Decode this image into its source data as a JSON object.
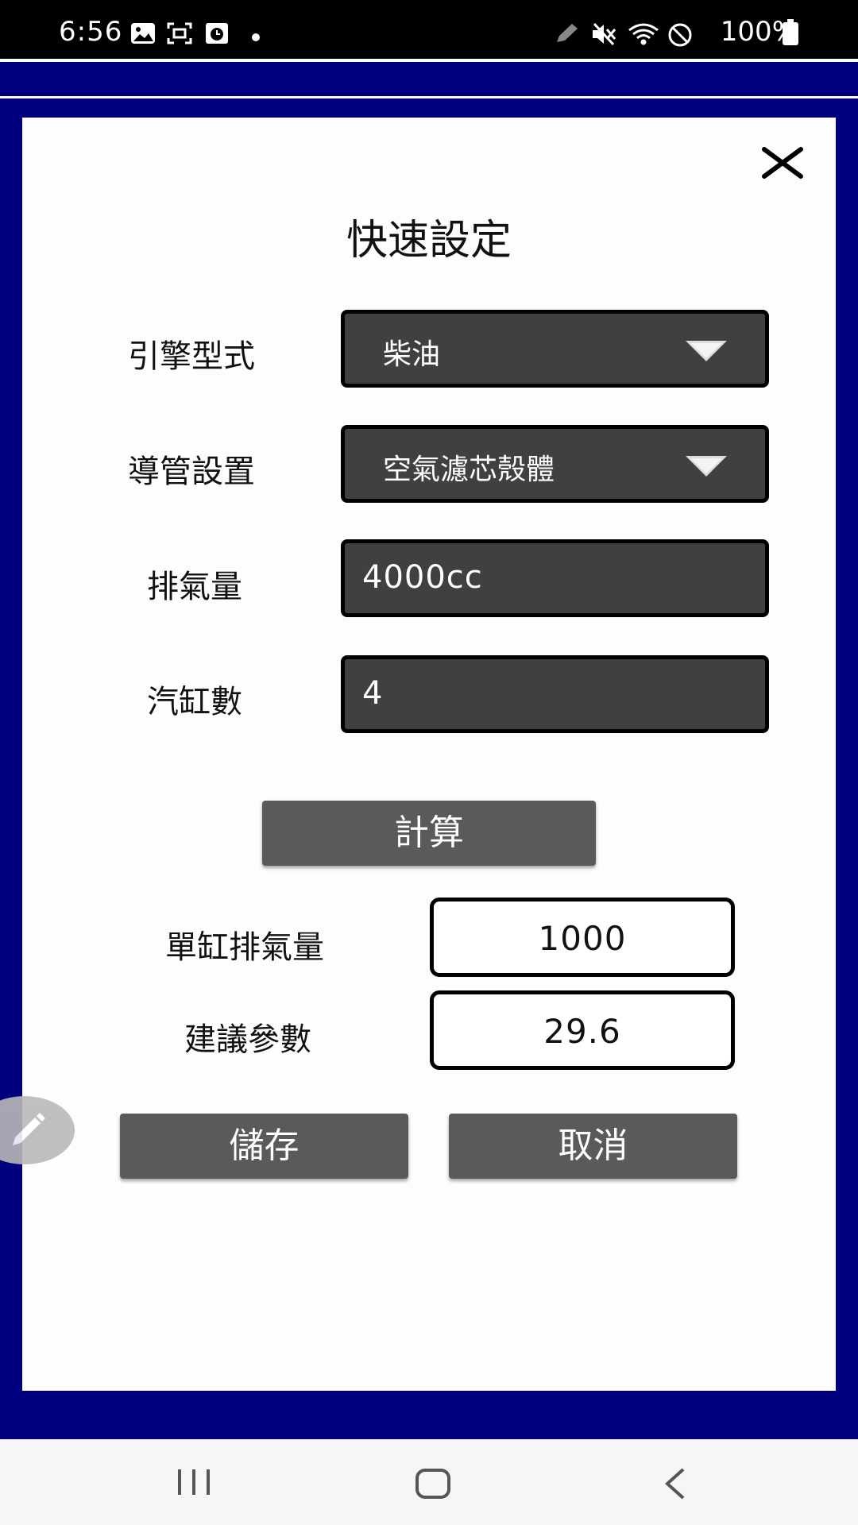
{
  "status_bar": {
    "time": "6:56",
    "battery_text": "100%",
    "icons": [
      "image-icon",
      "screenshot-icon",
      "timer-app-icon",
      "dot-icon",
      "pen-icon",
      "mute-icon",
      "wifi-icon",
      "no-disturb-icon",
      "battery-icon"
    ]
  },
  "dialog": {
    "title": "快速設定",
    "engine_type": {
      "label": "引擎型式",
      "value": "柴油"
    },
    "duct_setting": {
      "label": "導管設置",
      "value": "空氣濾芯殼體"
    },
    "displacement": {
      "label": "排氣量",
      "value": "4000cc"
    },
    "cylinders": {
      "label": "汽缸數",
      "value": "4"
    },
    "calculate_label": "計算",
    "single_cyl_displacement": {
      "label": "單缸排氣量",
      "value": "1000"
    },
    "suggested_param": {
      "label": "建議參數",
      "value": "29.6"
    },
    "save_label": "儲存",
    "cancel_label": "取消"
  },
  "colors": {
    "frame_blue": "#00007f",
    "field_dark": "#404040",
    "button_gray": "#5a5a5c"
  }
}
